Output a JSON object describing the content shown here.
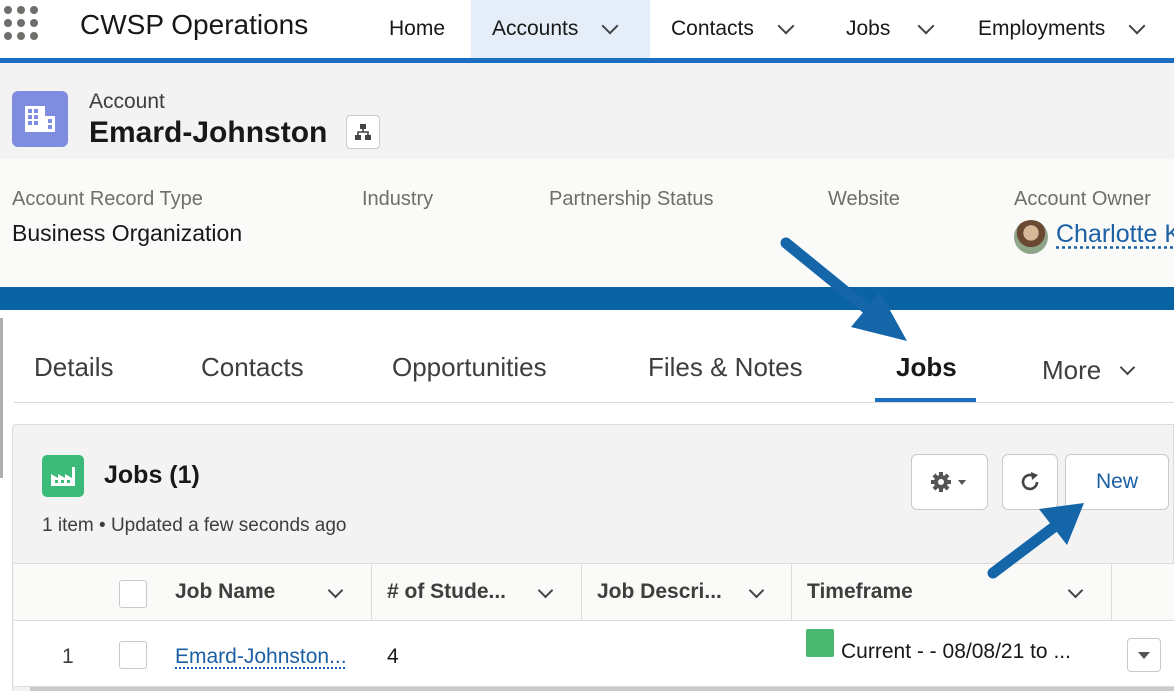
{
  "app": {
    "name": "CWSP Operations"
  },
  "nav": {
    "tabs": [
      {
        "label": "Home"
      },
      {
        "label": "Accounts"
      },
      {
        "label": "Contacts"
      },
      {
        "label": "Jobs"
      },
      {
        "label": "Employments"
      }
    ],
    "active": "Accounts"
  },
  "record": {
    "object_label": "Account",
    "name": "Emard-Johnston",
    "icon": "account-building-icon"
  },
  "highlights": {
    "fields": [
      {
        "label": "Account Record Type",
        "value": "Business Organization"
      },
      {
        "label": "Industry",
        "value": ""
      },
      {
        "label": "Partnership Status",
        "value": ""
      },
      {
        "label": "Website",
        "value": ""
      },
      {
        "label": "Account Owner",
        "value": "Charlotte K"
      }
    ]
  },
  "record_tabs": {
    "items": [
      {
        "label": "Details"
      },
      {
        "label": "Contacts"
      },
      {
        "label": "Opportunities"
      },
      {
        "label": "Files & Notes"
      },
      {
        "label": "Jobs"
      },
      {
        "label": "More"
      }
    ],
    "active": "Jobs"
  },
  "related_list": {
    "title": "Jobs (1)",
    "meta": "1 item • Updated a few seconds ago",
    "icon": "factory-icon",
    "buttons": {
      "settings": "gear-icon",
      "refresh": "refresh-icon",
      "new": "New"
    },
    "columns": [
      {
        "label": "Job Name"
      },
      {
        "label": "# of Stude..."
      },
      {
        "label": "Job Descri..."
      },
      {
        "label": "Timeframe"
      }
    ],
    "rows": [
      {
        "index": "1",
        "job_name": "Emard-Johnston...",
        "students": "4",
        "description": "",
        "timeframe": "Current - - 08/08/21 to ...",
        "status_color": "#4bb871"
      }
    ]
  },
  "colors": {
    "accent": "#1b6ec2",
    "band": "#0a64a4",
    "link": "#1b5fa4",
    "account_icon": "#7f8de1",
    "jobs_icon": "#3bba79",
    "annotation_arrow": "#1466a8"
  }
}
